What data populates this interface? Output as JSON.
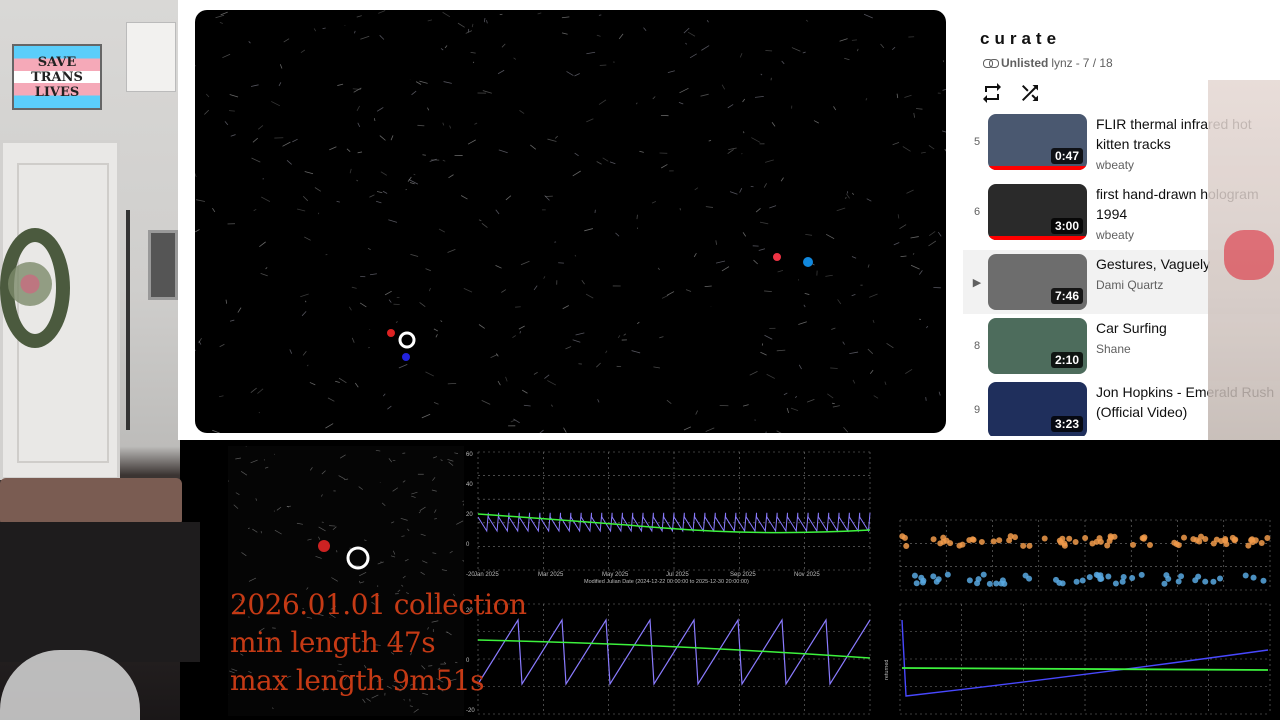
{
  "room_sign": {
    "line1": "SAVE",
    "line2": "TRANS",
    "line3": "LIVES"
  },
  "playlist": {
    "title": "curate",
    "visibility": "Unlisted",
    "owner": "lynz",
    "position": "7 / 18",
    "position_sep": " - ",
    "loop_icon": "loop-icon",
    "shuffle_icon": "shuffle-icon",
    "items": [
      {
        "index": "5",
        "title": "FLIR thermal infrared hot kitten tracks",
        "channel": "wbeaty",
        "duration": "0:47",
        "thumb": "#4a5870"
      },
      {
        "index": "6",
        "title": "first hand-drawn hologram 1994",
        "channel": "wbeaty",
        "duration": "3:00",
        "thumb": "#2a2a2a"
      },
      {
        "index": "▶",
        "title": "Gestures, Vaguely",
        "channel": "Dami Quartz",
        "duration": "7:46",
        "thumb": "#6d6d6d"
      },
      {
        "index": "8",
        "title": "Car Surfing",
        "channel": "Shane",
        "duration": "2:10",
        "thumb": "#4d6c5c"
      },
      {
        "index": "9",
        "title": "Jon Hopkins - Emerald Rush (Official Video)",
        "channel": "",
        "duration": "3:23",
        "thumb": "#1f2f5c"
      }
    ]
  },
  "overlay": {
    "line1": "2026.01.01 collection",
    "line2": "min length 47s",
    "line3": "max length 9m51s"
  },
  "chart_data": [
    {
      "type": "line",
      "title": "",
      "xlabel": "Modified Julian Date (2024-12-22 00:00:00 to 2025-12-30 20:00:00)",
      "x_ticks": [
        "Jan 2025",
        "Mar 2025",
        "May 2025",
        "Jul 2025",
        "Sep 2025",
        "Nov 2025"
      ],
      "y_ticks": [
        "60",
        "40",
        "20",
        "0",
        "-20"
      ],
      "ylabel": "returned",
      "series": [
        {
          "name": "",
          "color": "#8a7bff"
        },
        {
          "name": "",
          "color": "#3df23d"
        }
      ]
    },
    {
      "type": "line",
      "title": "",
      "xlabel": "",
      "ylabel": "returned",
      "y_ticks": [
        "20",
        "0",
        "-20"
      ],
      "series": [
        {
          "name": "",
          "color": "#8a7bff"
        },
        {
          "name": "",
          "color": "#3df23d"
        }
      ]
    },
    {
      "type": "scatter",
      "title": "",
      "xlabel": "",
      "ylabel": "",
      "series": [
        {
          "name": "",
          "color": "#f09a4a"
        },
        {
          "name": "",
          "color": "#58a8e0"
        }
      ]
    },
    {
      "type": "line",
      "title": "",
      "xlabel": "",
      "ylabel": "returned",
      "series": [
        {
          "name": "",
          "color": "#4848ff"
        },
        {
          "name": "",
          "color": "#3df23d"
        }
      ]
    }
  ]
}
